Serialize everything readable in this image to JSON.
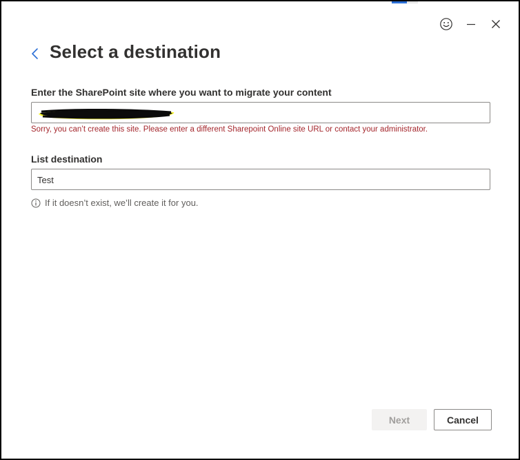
{
  "dialog": {
    "title": "Select a destination",
    "controls": {
      "feedback_icon": "smiley-icon",
      "minimize_icon": "minimize-icon",
      "close_icon": "close-icon"
    },
    "back_icon": "chevron-left-icon"
  },
  "site_field": {
    "label": "Enter the SharePoint site where you want to migrate your content",
    "value": "",
    "redacted": true,
    "error": "Sorry, you can’t create this site. Please enter a different Sharepoint Online site URL or contact your administrator."
  },
  "list_field": {
    "label": "List destination",
    "value": "Test",
    "hint_icon": "info-icon",
    "hint": "If it doesn’t exist, we’ll create it for you."
  },
  "footer": {
    "next_label": "Next",
    "next_disabled": true,
    "cancel_label": "Cancel"
  },
  "colors": {
    "accent": "#2b6fd6",
    "error": "#a4262c",
    "text": "#323130",
    "disabled_bg": "#f3f2f1"
  }
}
